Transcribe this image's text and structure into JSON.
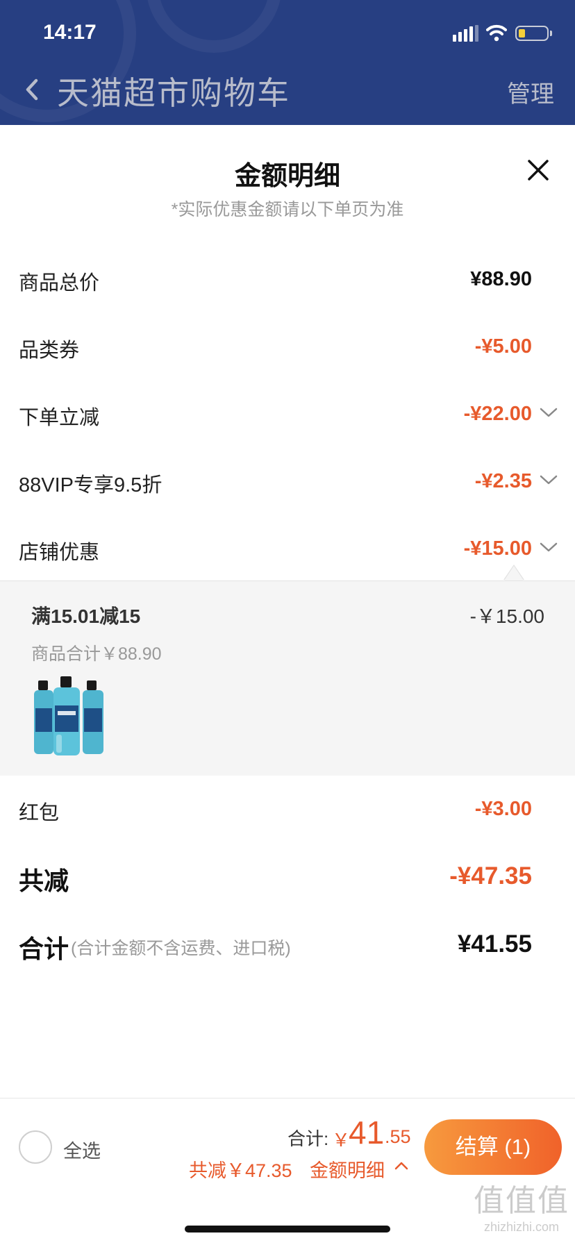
{
  "status_bar": {
    "time": "14:17"
  },
  "nav": {
    "title": "天猫超市购物车",
    "manage": "管理"
  },
  "sheet": {
    "title": "金额明细",
    "subtitle": "*实际优惠金额请以下单页为准"
  },
  "rows": [
    {
      "label": "商品总价",
      "value": "¥88.90"
    },
    {
      "label": "品类券",
      "value": "-¥5.00"
    },
    {
      "label": "下单立减",
      "value": "-¥22.00"
    },
    {
      "label": "88VIP专享9.5折",
      "value": "-¥2.35"
    },
    {
      "label": "店铺优惠",
      "value": "-¥15.00"
    }
  ],
  "promo": {
    "title": "满15.01减15",
    "amount": "-￥15.00",
    "subtotal": "商品合计￥88.90",
    "product_icon": "listerine-mouthwash-bottles-image"
  },
  "red_packet": {
    "label": "红包",
    "value": "-¥3.00"
  },
  "total_discount": {
    "label": "共减",
    "value": "-¥47.35"
  },
  "grand_total": {
    "label": "合计",
    "note": "(合计金额不含运费、进口税)",
    "value": "¥41.55"
  },
  "bottom_bar": {
    "select_all": "全选",
    "sum_label": "合计:",
    "currency": "￥",
    "sum_integer": "41",
    "sum_decimal": ".55",
    "discount_text": "共减￥47.35",
    "detail_link": "金额明细",
    "checkout": "结算 (1)"
  },
  "watermark": {
    "main": "值值值",
    "sub": "zhizhizhi.com"
  },
  "colors": {
    "header_bg": "#273f82",
    "accent_orange": "#e75a2c",
    "checkout_start": "#f79a3e",
    "checkout_end": "#f0622a"
  }
}
